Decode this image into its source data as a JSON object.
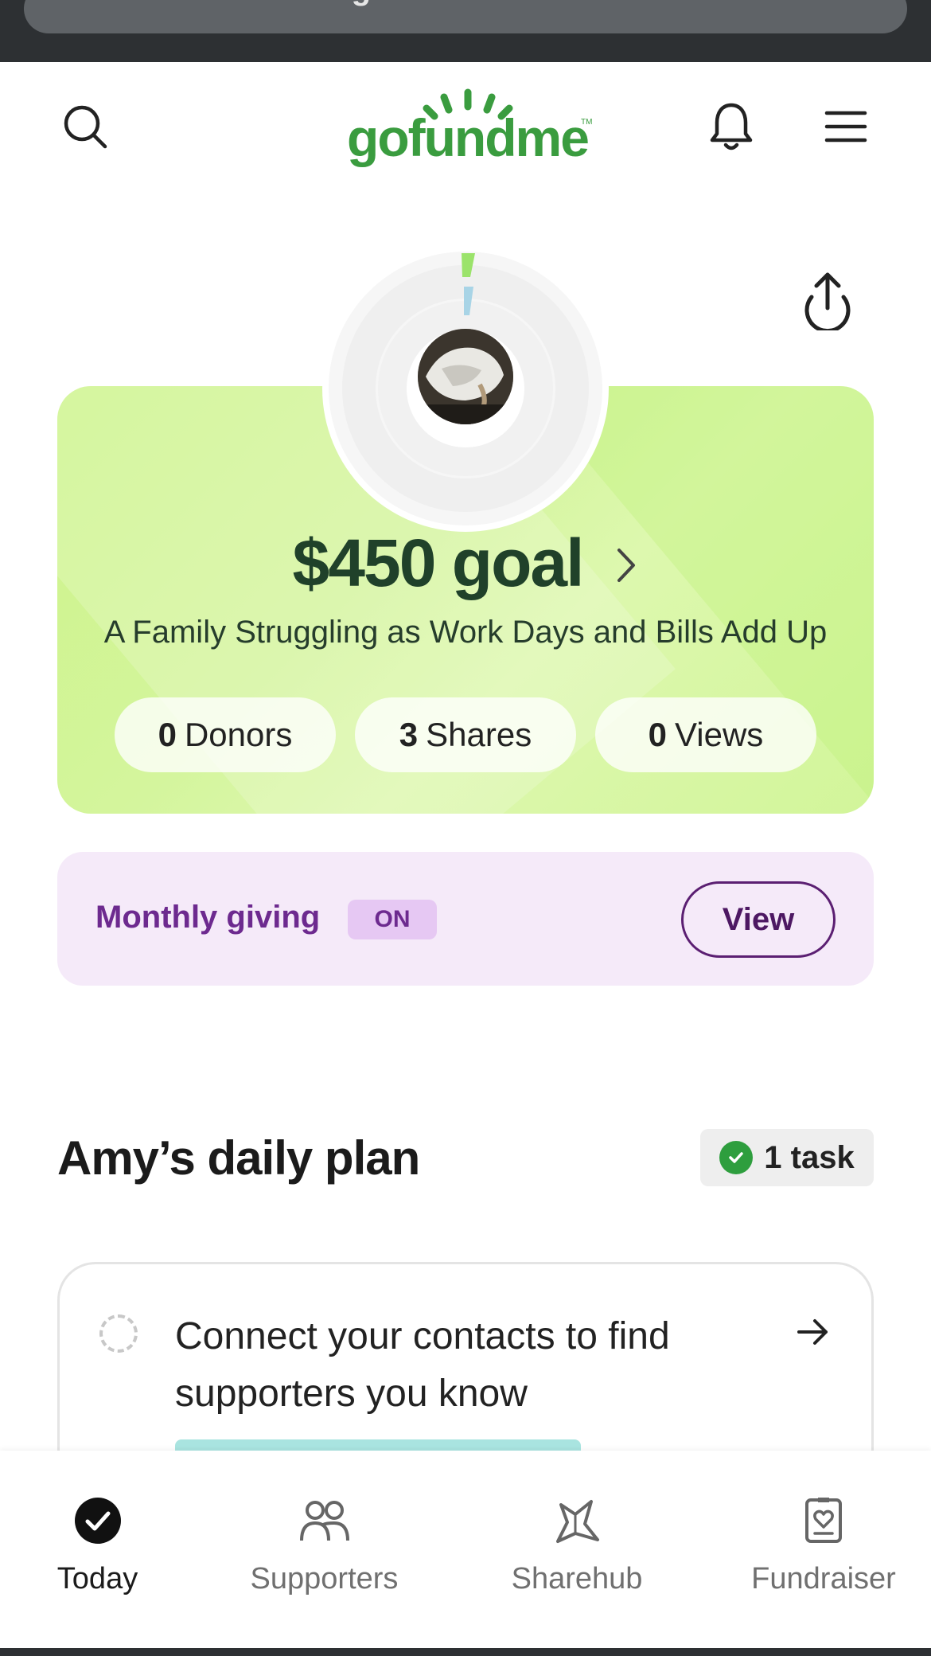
{
  "browser": {
    "url": "gofundme.com"
  },
  "header": {
    "logo_text": "gofundme",
    "logo_tm": "TM",
    "brand_color": "#3a9c3f",
    "icons": [
      "search-icon",
      "bell-icon",
      "menu-icon"
    ]
  },
  "goal_card": {
    "goal": "$450 goal",
    "campaign_title": "A Family Struggling as Work Days and Bills Add Up",
    "stats": [
      {
        "count": "0",
        "label": "Donors"
      },
      {
        "count": "3",
        "label": "Shares"
      },
      {
        "count": "0",
        "label": "Views"
      }
    ],
    "card_color": "#d2f59a"
  },
  "monthly": {
    "label": "Monthly giving",
    "badge": "ON",
    "view_label": "View",
    "accent_color": "#6d2a8f"
  },
  "plan": {
    "title": "Amy’s daily plan",
    "task_count": "1 task",
    "task_text": "Connect your contacts to find supporters you know"
  },
  "bottom_nav": {
    "items": [
      {
        "label": "Today",
        "icon": "check-circle-icon",
        "active": true
      },
      {
        "label": "Supporters",
        "icon": "people-icon",
        "active": false
      },
      {
        "label": "Sharehub",
        "icon": "share-star-icon",
        "active": false
      },
      {
        "label": "Fundraiser",
        "icon": "fundraiser-icon",
        "active": false
      }
    ]
  }
}
